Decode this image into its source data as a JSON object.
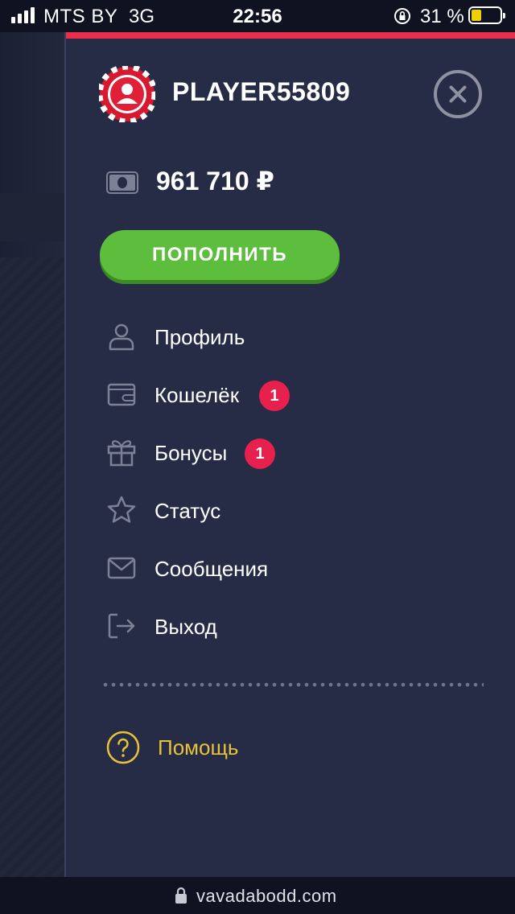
{
  "status_bar": {
    "carrier": "MTS BY",
    "network": "3G",
    "time": "22:56",
    "battery_percent": "31 %",
    "battery_level": 0.31
  },
  "drawer": {
    "username": "PLAYER55809",
    "balance": "961 710 ₽",
    "deposit_label": "ПОПОЛНИТЬ",
    "menu": [
      {
        "label": "Профиль",
        "icon": "user-icon",
        "badge": ""
      },
      {
        "label": "Кошелёк",
        "icon": "wallet-icon",
        "badge": "1"
      },
      {
        "label": "Бонусы",
        "icon": "gift-icon",
        "badge": "1"
      },
      {
        "label": "Статус",
        "icon": "star-icon",
        "badge": ""
      },
      {
        "label": "Сообщения",
        "icon": "envelope-icon",
        "badge": ""
      },
      {
        "label": "Выход",
        "icon": "logout-icon",
        "badge": ""
      }
    ],
    "help_label": "Помощь"
  },
  "url_bar": {
    "url": "vavadabodd.com"
  },
  "colors": {
    "accent_red": "#ea2e4c",
    "deposit_green": "#5cbe3c",
    "help_yellow": "#e8c33a",
    "drawer_bg": "#272c46"
  }
}
